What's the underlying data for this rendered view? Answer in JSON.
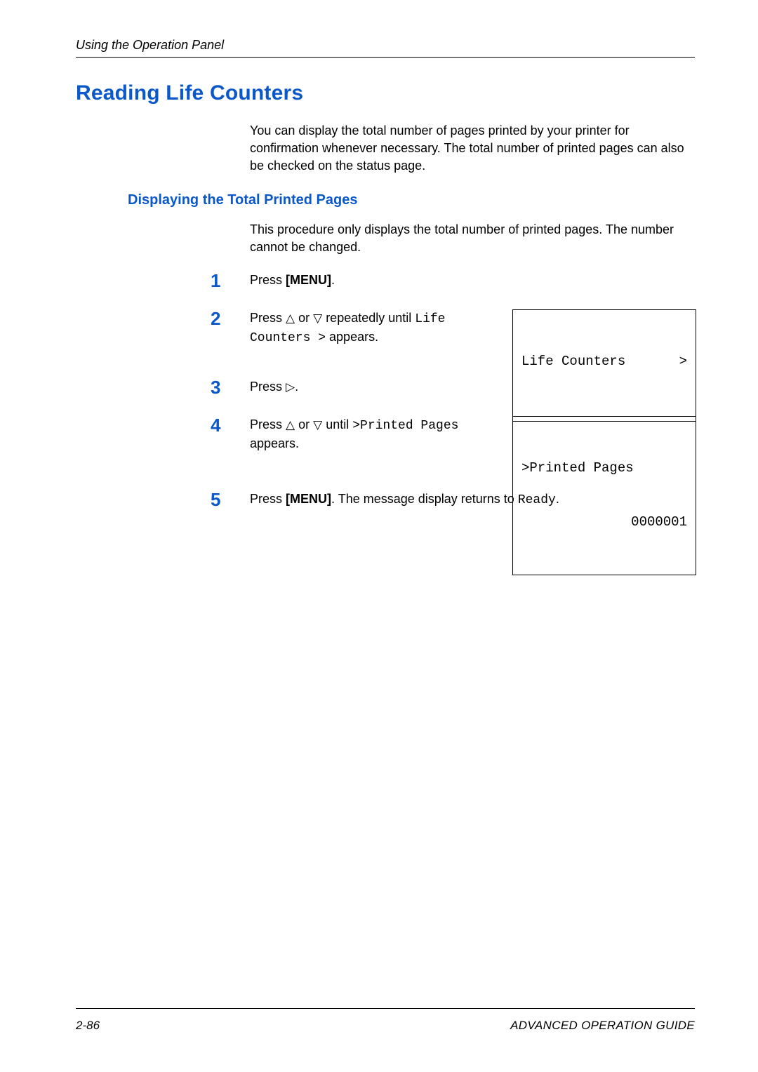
{
  "header": {
    "running_head": "Using the Operation Panel"
  },
  "title": "Reading Life Counters",
  "intro": "You can display the total number of pages printed by your printer for confirmation whenever necessary. The total number of printed pages can also be checked on the status page.",
  "subheading": "Displaying the Total Printed Pages",
  "sub_intro": "This procedure only displays the total number of printed pages. The number cannot be changed.",
  "symbols": {
    "up": "△",
    "down": "▽",
    "right": "▷"
  },
  "steps": {
    "s1": {
      "num": "1",
      "pre": "Press ",
      "menu": "[MENU]",
      "post": "."
    },
    "s2": {
      "num": "2",
      "pre1": "Press ",
      "mid": " or ",
      "post1": " repeatedly until ",
      "mono1": "Life Counters >",
      "post2": " appears.",
      "display_l1_left": "Life Counters",
      "display_l1_right": ">"
    },
    "s3": {
      "num": "3",
      "pre": "Press ",
      "post": "."
    },
    "s4": {
      "num": "4",
      "pre1": "Press ",
      "mid": " or ",
      "post1": " until ",
      "mono1": ">Printed Pages",
      "post2": " appears.",
      "display_l1": ">Printed Pages",
      "display_l2": "0000001"
    },
    "s5": {
      "num": "5",
      "pre": "Press ",
      "menu": "[MENU]",
      "mid": ". The message display returns to ",
      "mono": "Ready",
      "post": "."
    }
  },
  "footer": {
    "page_num": "2-86",
    "guide": "ADVANCED OPERATION GUIDE"
  }
}
